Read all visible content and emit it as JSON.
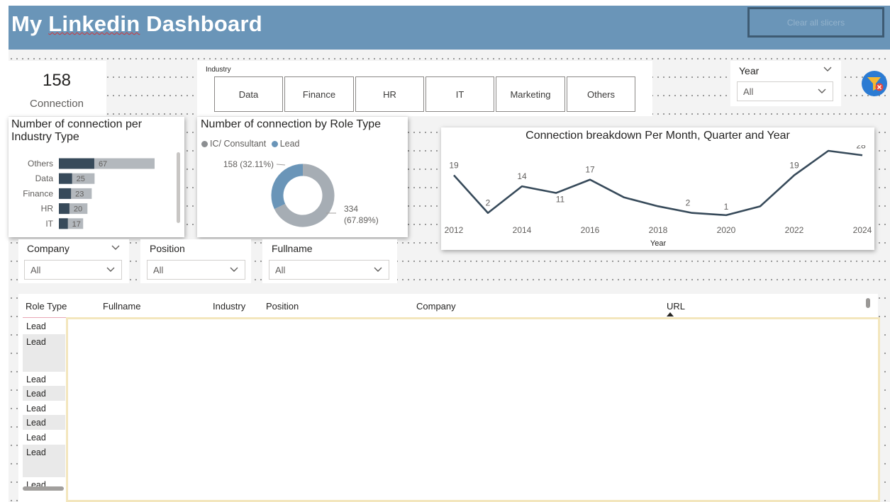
{
  "header": {
    "title_part1": "My ",
    "title_part2": "Linkedin",
    "title_part3": " Dashboard",
    "clear_label": "Clear all slicers"
  },
  "kpi": {
    "value": "158",
    "label": "Connection"
  },
  "industry_slicer": {
    "title": "Industry",
    "options": [
      "Data",
      "Finance",
      "HR",
      "IT",
      "Marketing",
      "Others"
    ]
  },
  "year_slicer": {
    "title": "Year",
    "value": "All"
  },
  "filters": [
    {
      "title": "Company",
      "value": "All"
    },
    {
      "title": "Position",
      "value": "All"
    },
    {
      "title": "Fullname",
      "value": "All"
    }
  ],
  "bar_chart_title": "Number of connection per Industry Type",
  "donut_chart_title": "Number of connection by Role Type",
  "line_chart_title": "Connection breakdown Per Month, Quarter and Year",
  "chart_data": [
    {
      "type": "bar",
      "orientation": "horizontal",
      "title": "Number of connection per Industry Type",
      "categories": [
        "Others",
        "Data",
        "Finance",
        "HR",
        "IT"
      ],
      "series": [
        {
          "values": [
            67,
            25,
            23,
            20,
            17
          ]
        }
      ],
      "colors": {
        "dark": "#374a5a",
        "light": "#b3b8bd"
      }
    },
    {
      "type": "pie",
      "title": "Number of connection by Role Type",
      "legend_position": "top-left",
      "categories": [
        "IC/ Consultant",
        "Lead"
      ],
      "values": [
        334,
        158
      ],
      "labels": [
        "334 (67.89%)",
        "158 (32.11%)"
      ],
      "colors": [
        "#a6adb4",
        "#6a95b8"
      ]
    },
    {
      "type": "line",
      "title": "Connection breakdown Per Month, Quarter and Year",
      "xlabel": "Year",
      "x_ticks": [
        "2012",
        "2014",
        "2016",
        "2018",
        "2020",
        "2022",
        "2024"
      ],
      "x": [
        2012,
        2013,
        2014,
        2015,
        2016,
        2017,
        2018,
        2019,
        2020,
        2021,
        2022,
        2023,
        2024
      ],
      "series": [
        {
          "values": [
            19,
            2,
            14,
            11,
            17,
            9,
            5,
            2,
            1,
            5,
            19,
            30,
            28
          ]
        }
      ],
      "data_labels": {
        "2012": "19",
        "2013": "2",
        "2014": "14",
        "2015": "11",
        "2016": "17",
        "2019": "2",
        "2020": "1",
        "2022": "19",
        "2023": "30",
        "2024": "28"
      },
      "ylim": [
        0,
        30
      ],
      "color": "#374a5a"
    }
  ],
  "table": {
    "columns": [
      "Role Type",
      "Fullname",
      "Industry",
      "Position",
      "Company",
      "URL"
    ],
    "rows": [
      "Lead",
      "Lead",
      "Lead",
      "Lead",
      "Lead",
      "Lead",
      "Lead",
      "Lead",
      "Lead"
    ]
  }
}
